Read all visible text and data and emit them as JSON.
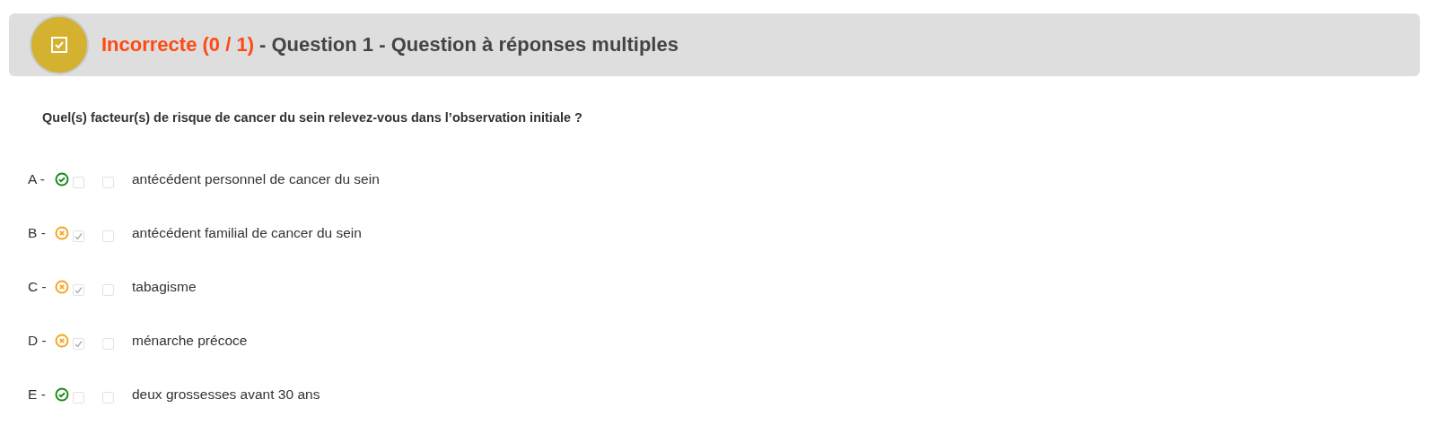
{
  "header": {
    "status": "Incorrecte (0 / 1)",
    "title": "- Question 1 - Question à réponses multiples"
  },
  "question": "Quel(s) facteur(s) de risque de cancer du sein relevez-vous dans l’observation initiale ?",
  "options": [
    {
      "letter": "A -",
      "kind": "correct",
      "correction_checked": false,
      "answer_checked": false,
      "text": "antécédent personnel de cancer du sein"
    },
    {
      "letter": "B -",
      "kind": "incorrect",
      "correction_checked": true,
      "answer_checked": false,
      "text": "antécédent familial de cancer du sein"
    },
    {
      "letter": "C -",
      "kind": "incorrect",
      "correction_checked": true,
      "answer_checked": false,
      "text": "tabagisme"
    },
    {
      "letter": "D -",
      "kind": "incorrect",
      "correction_checked": true,
      "answer_checked": false,
      "text": "ménarche précoce"
    },
    {
      "letter": "E -",
      "kind": "correct",
      "correction_checked": false,
      "answer_checked": false,
      "text": "deux grossesses avant 30 ans"
    }
  ]
}
